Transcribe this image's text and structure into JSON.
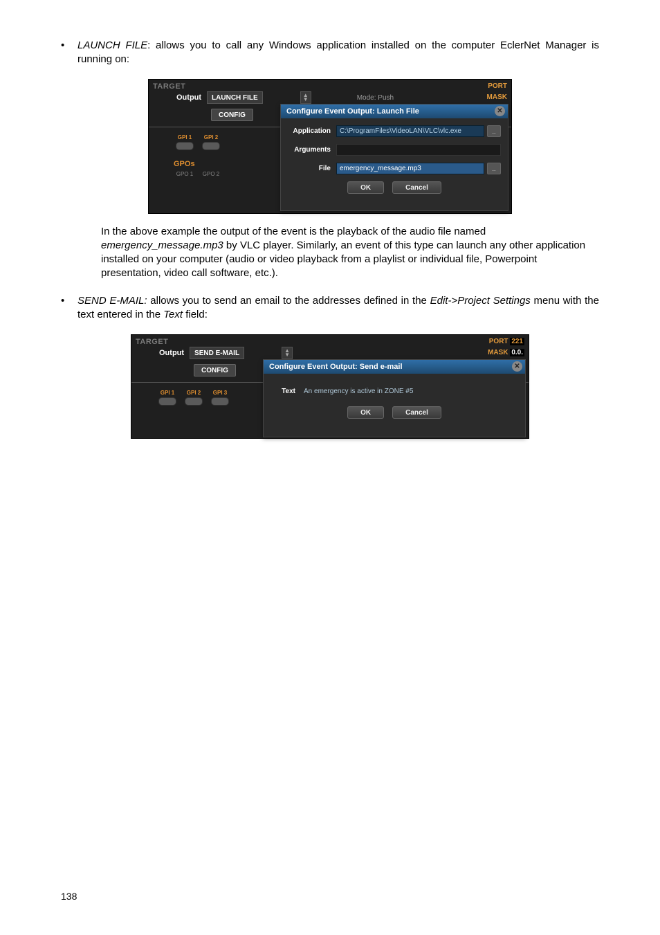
{
  "bullets": {
    "b1": {
      "term": "LAUNCH FILE",
      "desc": ": allows you to call any Windows application installed on the computer EclerNet Manager is running on:"
    },
    "b2": {
      "term": "SEND E-MAIL:",
      "desc": " allows you to send an email to the addresses defined in the ",
      "path": "Edit->Project Settings",
      "desc2": " menu with the text entered in the ",
      "field": "Text",
      "desc3": " field:"
    }
  },
  "explain": {
    "p1a": "In the above example the output of the event is the playback of the audio file named ",
    "p1b": "emergency_message.mp3",
    "p1c": " by VLC player. Similarly, an event of this type can launch any other application installed on your computer (audio or video playback from a playlist or individual file, Powerpoint presentation, video call software, etc.)."
  },
  "ss1": {
    "target": "TARGET",
    "port": "PORT",
    "mask": "MASK",
    "output_lbl": "Output",
    "output_val": "LAUNCH FILE",
    "mode": "Mode: Push",
    "config": "CONFIG",
    "gpi": [
      "GPI 1",
      "GPI 2"
    ],
    "gpos": "GPOs",
    "gpo": [
      "GPO 1",
      "GPO 2"
    ],
    "dialog": {
      "title": "Configure Event Output: Launch File",
      "app_lbl": "Application",
      "app_val": "C:\\ProgramFiles\\VideoLAN\\VLC\\vlc.exe",
      "args_lbl": "Arguments",
      "file_lbl": "File",
      "file_val": "emergency_message.mp3",
      "browse": "..",
      "ok": "OK",
      "cancel": "Cancel"
    }
  },
  "ss2": {
    "target": "TARGET",
    "port": "PORT",
    "port_val": "221",
    "mask": "MASK",
    "mask_val": "0.0.",
    "output_lbl": "Output",
    "output_val": "SEND E-MAIL",
    "config": "CONFIG",
    "gpi": [
      "GPI 1",
      "GPI 2",
      "GPI 3"
    ],
    "dialog": {
      "title": "Configure Event Output: Send e-mail",
      "text_lbl": "Text",
      "text_val": "An emergency is active in ZONE #5",
      "ok": "OK",
      "cancel": "Cancel"
    }
  },
  "page_num": "138"
}
